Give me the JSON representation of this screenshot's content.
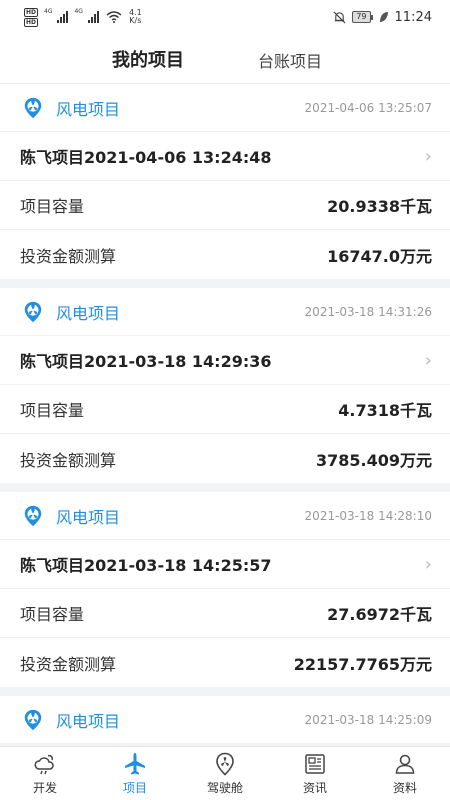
{
  "status_bar": {
    "hd_1": "HD",
    "hd_2": "HD",
    "sig_label_1": "4G",
    "sig_label_2": "4G",
    "net_speed": "4.1",
    "net_unit": "K/s",
    "battery": "79",
    "time": "11:24"
  },
  "tabs": [
    {
      "label": "我的项目",
      "active": true
    },
    {
      "label": "台账项目",
      "active": false
    }
  ],
  "projects": [
    {
      "category": "风电项目",
      "timestamp": "2021-04-06 13:25:07",
      "title": "陈飞项目2021-04-06 13:24:48",
      "capacity_label": "项目容量",
      "capacity_value": "20.9338千瓦",
      "investment_label": "投资金额测算",
      "investment_value": "16747.0万元"
    },
    {
      "category": "风电项目",
      "timestamp": "2021-03-18 14:31:26",
      "title": "陈飞项目2021-03-18 14:29:36",
      "capacity_label": "项目容量",
      "capacity_value": "4.7318千瓦",
      "investment_label": "投资金额测算",
      "investment_value": "3785.409万元"
    },
    {
      "category": "风电项目",
      "timestamp": "2021-03-18 14:28:10",
      "title": "陈飞项目2021-03-18 14:25:57",
      "capacity_label": "项目容量",
      "capacity_value": "27.6972千瓦",
      "investment_label": "投资金额测算",
      "investment_value": "22157.7765万元"
    },
    {
      "category": "风电项目",
      "timestamp": "2021-03-18 14:25:09"
    }
  ],
  "bottom_nav": [
    {
      "label": "开发",
      "icon": "cloud-sun-icon",
      "active": false
    },
    {
      "label": "项目",
      "icon": "airplane-icon",
      "active": true
    },
    {
      "label": "驾驶舱",
      "icon": "map-pin-fan-icon",
      "active": false
    },
    {
      "label": "资讯",
      "icon": "newspaper-icon",
      "active": false
    },
    {
      "label": "资料",
      "icon": "user-icon",
      "active": false
    }
  ],
  "colors": {
    "accent": "#1f8fe0",
    "background": "#f2f3f5"
  }
}
